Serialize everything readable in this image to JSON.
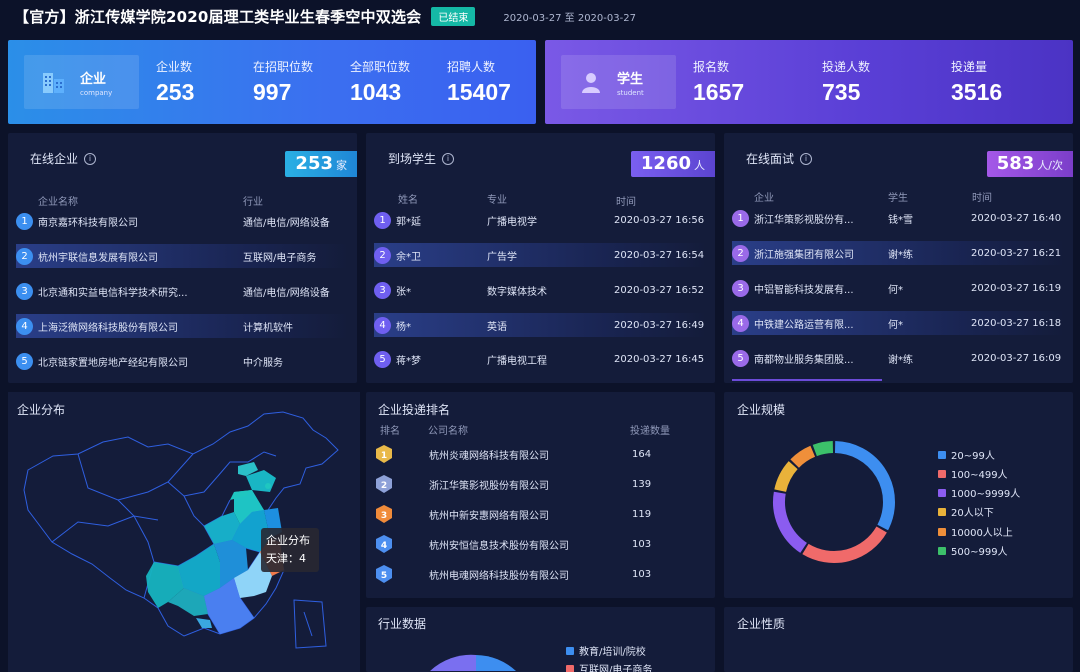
{
  "header": {
    "title": "【官方】浙江传媒学院2020届理工类毕业生春季空中双选会",
    "status_badge": "已结束",
    "date_range": "2020-03-27 至 2020-03-27"
  },
  "company_stats": {
    "title": "企业",
    "subtitle": "company",
    "items": [
      {
        "label": "企业数",
        "value": "253"
      },
      {
        "label": "在招职位数",
        "value": "997"
      },
      {
        "label": "全部职位数",
        "value": "1043"
      },
      {
        "label": "招聘人数",
        "value": "15407"
      }
    ]
  },
  "student_stats": {
    "title": "学生",
    "subtitle": "student",
    "items": [
      {
        "label": "报名数",
        "value": "1657"
      },
      {
        "label": "投递人数",
        "value": "735"
      },
      {
        "label": "投递量",
        "value": "3516"
      }
    ]
  },
  "online_companies": {
    "title": "在线企业",
    "info_icon": "i",
    "count": "253",
    "unit": "家",
    "headers": [
      "企业名称",
      "行业"
    ],
    "rows": [
      {
        "n": "1",
        "name": "南京嘉环科技有限公司",
        "industry": "通信/电信/网络设备"
      },
      {
        "n": "2",
        "name": "杭州宇联信息发展有限公司",
        "industry": "互联网/电子商务"
      },
      {
        "n": "3",
        "name": "北京通和实益电信科学技术研究...",
        "industry": "通信/电信/网络设备"
      },
      {
        "n": "4",
        "name": "上海泛微网络科技股份有限公司",
        "industry": "计算机软件"
      },
      {
        "n": "5",
        "name": "北京链家置地房地产经纪有限公司",
        "industry": "中介服务"
      }
    ]
  },
  "students": {
    "title": "到场学生",
    "info_icon": "i",
    "count": "1260",
    "unit": "人",
    "headers": [
      "姓名",
      "专业",
      "时间"
    ],
    "rows": [
      {
        "n": "1",
        "name": "郭*延",
        "major": "广播电视学",
        "time": "2020-03-27 16:56"
      },
      {
        "n": "2",
        "name": "余*卫",
        "major": "广告学",
        "time": "2020-03-27 16:54"
      },
      {
        "n": "3",
        "name": "张*",
        "major": "数字媒体技术",
        "time": "2020-03-27 16:52"
      },
      {
        "n": "4",
        "name": "杨*",
        "major": "英语",
        "time": "2020-03-27 16:49"
      },
      {
        "n": "5",
        "name": "蒋*梦",
        "major": "广播电视工程",
        "time": "2020-03-27 16:45"
      }
    ]
  },
  "interviews": {
    "title": "在线面试",
    "info_icon": "i",
    "count": "583",
    "unit": "人/次",
    "headers": [
      "企业",
      "学生",
      "时间"
    ],
    "rows": [
      {
        "n": "1",
        "company": "浙江华策影视股份有...",
        "student": "钱*雪",
        "time": "2020-03-27 16:40"
      },
      {
        "n": "2",
        "company": "浙江施强集团有限公司",
        "student": "谢*练",
        "time": "2020-03-27 16:21"
      },
      {
        "n": "3",
        "company": "中铝智能科技发展有...",
        "student": "何*",
        "time": "2020-03-27 16:19"
      },
      {
        "n": "4",
        "company": "中铁建公路运营有限...",
        "student": "何*",
        "time": "2020-03-27 16:18"
      },
      {
        "n": "5",
        "company": "南都物业服务集团股...",
        "student": "谢*练",
        "time": "2020-03-27 16:09"
      }
    ]
  },
  "distribution": {
    "title": "企业分布",
    "tooltip_title": "企业分布",
    "tooltip_value": "天津：4"
  },
  "ranking": {
    "title": "企业投递排名",
    "headers": [
      "排名",
      "公司名称",
      "投递数量"
    ],
    "rows": [
      {
        "rank": "1",
        "name": "杭州炎魂网络科技有限公司",
        "count": "164",
        "color": "#e9b949"
      },
      {
        "rank": "2",
        "name": "浙江华策影视股份有限公司",
        "count": "139",
        "color": "#8ea1d8"
      },
      {
        "rank": "3",
        "name": "杭州中新安惠网络有限公司",
        "count": "119",
        "color": "#f08b3a"
      },
      {
        "rank": "4",
        "name": "杭州安恒信息技术股份有限公司",
        "count": "103",
        "color": "#4d8ff0"
      },
      {
        "rank": "5",
        "name": "杭州电魂网络科技股份有限公司",
        "count": "103",
        "color": "#4d8ff0"
      }
    ]
  },
  "scale": {
    "title": "企业规模",
    "legend": [
      {
        "label": "20~99人",
        "color": "#3d8ef0"
      },
      {
        "label": "100~499人",
        "color": "#f06a6a"
      },
      {
        "label": "1000~9999人",
        "color": "#8b5cf0"
      },
      {
        "label": "20人以下",
        "color": "#e9b23a"
      },
      {
        "label": "10000人以上",
        "color": "#ef8f3a"
      },
      {
        "label": "500~999人",
        "color": "#3cc06a"
      }
    ],
    "shares": [
      0.33,
      0.26,
      0.19,
      0.09,
      0.07,
      0.06
    ]
  },
  "industry": {
    "title": "行业数据",
    "legend": [
      {
        "label": "教育/培训/院校",
        "color": "#3d8ef0"
      },
      {
        "label": "互联网/电子商务",
        "color": "#f06a6a"
      }
    ]
  },
  "nature": {
    "title": "企业性质"
  }
}
